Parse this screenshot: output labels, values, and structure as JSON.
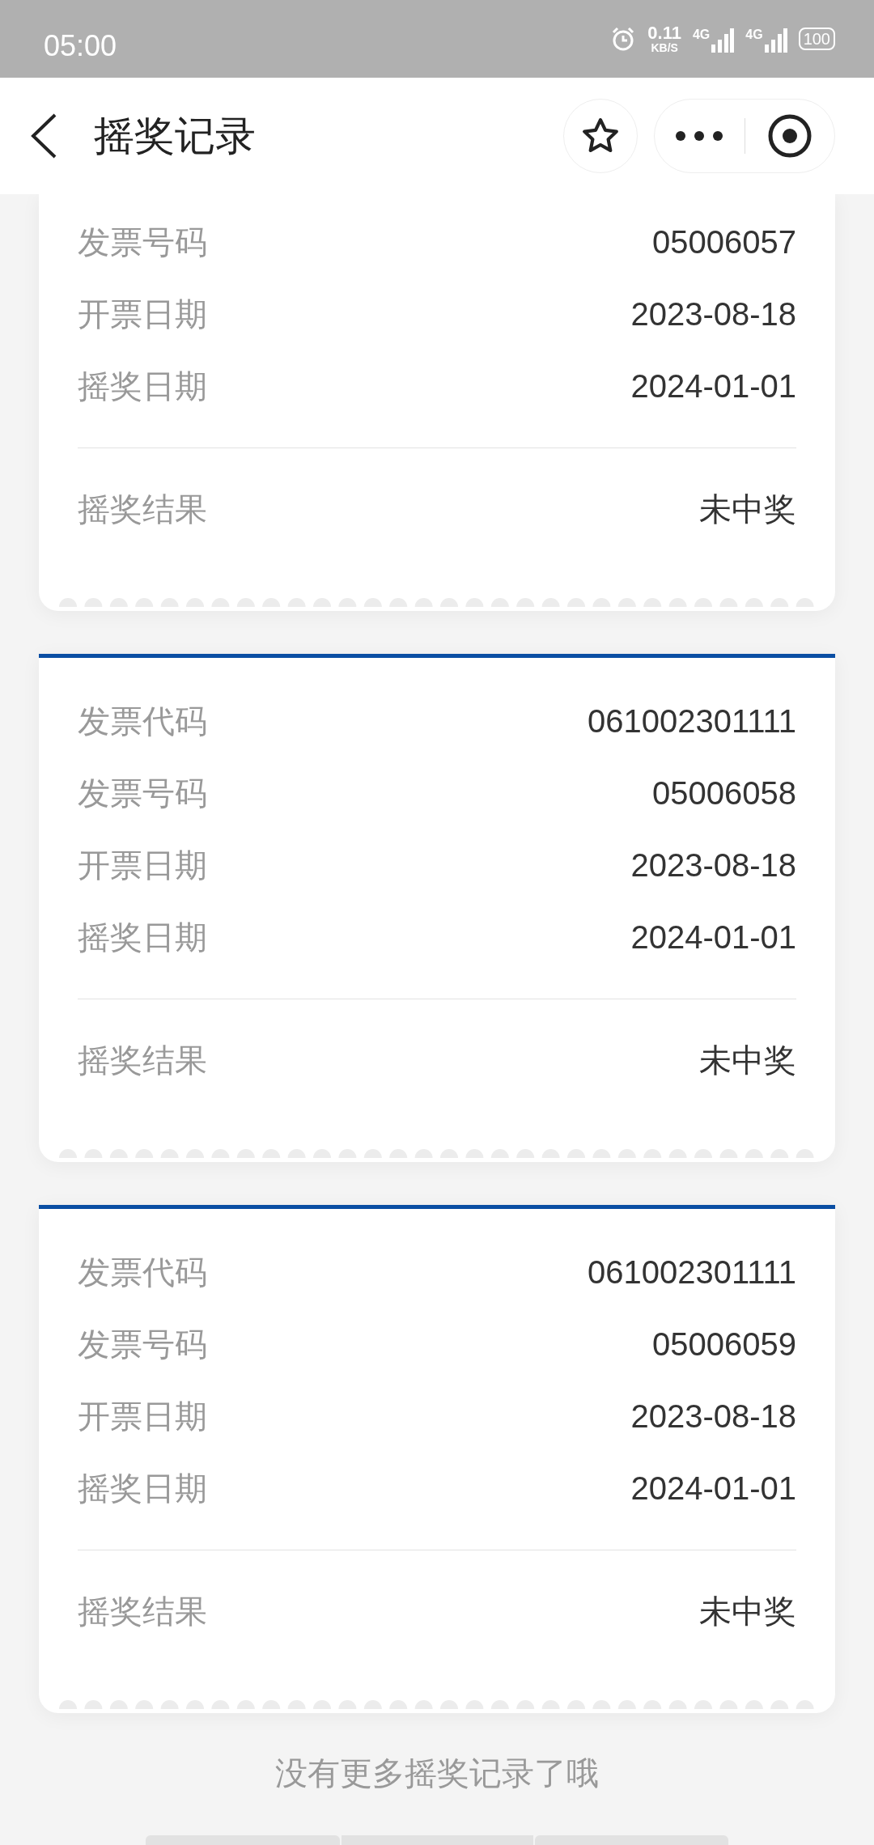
{
  "status_bar": {
    "time": "05:00",
    "net_speed": "0.11",
    "net_speed_unit": "KB/S",
    "signals": [
      {
        "label": "4G"
      },
      {
        "label": "4G"
      }
    ],
    "battery": "100"
  },
  "header": {
    "title": "摇奖记录"
  },
  "records": [
    {
      "cut_top": true,
      "fields": [
        {
          "label": "发票号码",
          "value": "05006057"
        },
        {
          "label": "开票日期",
          "value": "2023-08-18"
        },
        {
          "label": "摇奖日期",
          "value": "2024-01-01"
        }
      ],
      "result": {
        "label": "摇奖结果",
        "value": "未中奖"
      }
    },
    {
      "cut_top": false,
      "fields": [
        {
          "label": "发票代码",
          "value": "061002301111"
        },
        {
          "label": "发票号码",
          "value": "05006058"
        },
        {
          "label": "开票日期",
          "value": "2023-08-18"
        },
        {
          "label": "摇奖日期",
          "value": "2024-01-01"
        }
      ],
      "result": {
        "label": "摇奖结果",
        "value": "未中奖"
      }
    },
    {
      "cut_top": false,
      "fields": [
        {
          "label": "发票代码",
          "value": "061002301111"
        },
        {
          "label": "发票号码",
          "value": "05006059"
        },
        {
          "label": "开票日期",
          "value": "2023-08-18"
        },
        {
          "label": "摇奖日期",
          "value": "2024-01-01"
        }
      ],
      "result": {
        "label": "摇奖结果",
        "value": "未中奖"
      }
    }
  ],
  "footer": "没有更多摇奖记录了哦"
}
